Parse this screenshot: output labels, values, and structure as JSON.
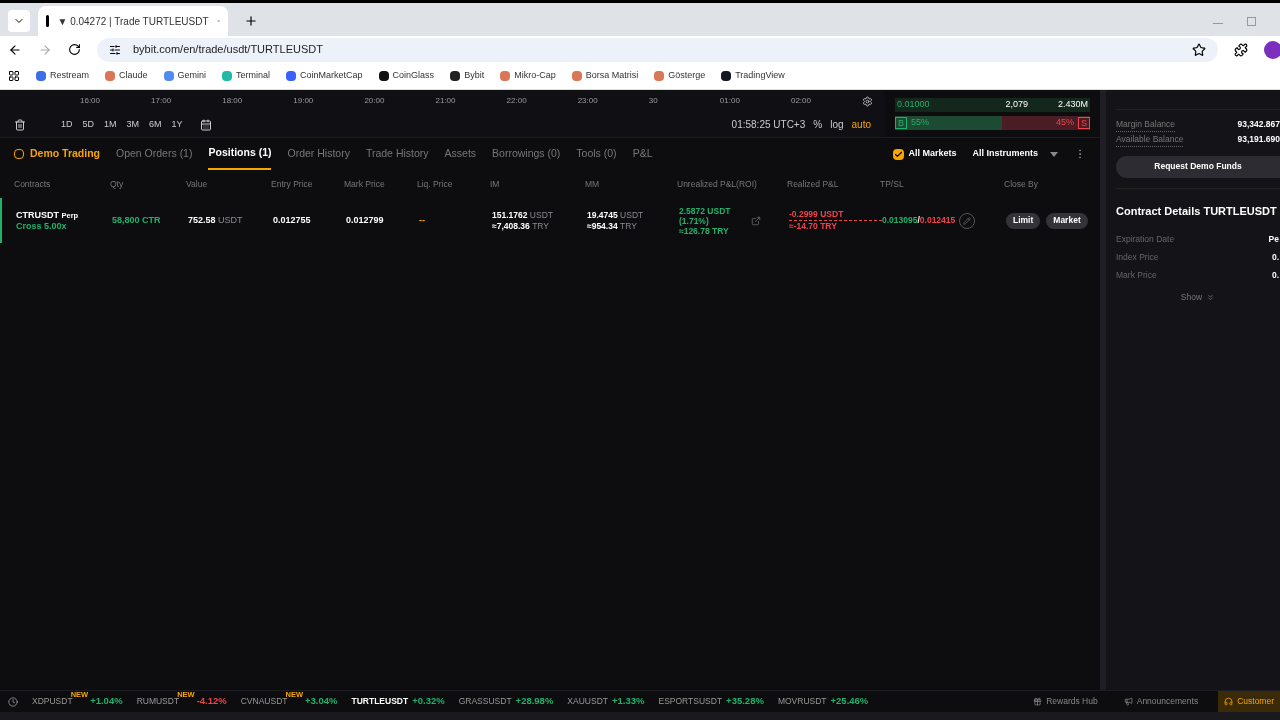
{
  "browser": {
    "tab_title": "▼ 0.04272 | Trade TURTLEUSDT",
    "url": "bybit.com/en/trade/usdt/TURTLEUSDT",
    "bookmarks": [
      {
        "label": "Restream",
        "color": "#3b6ee8"
      },
      {
        "label": "Claude",
        "color": "#d97757"
      },
      {
        "label": "Gemini",
        "color": "#4e8cf0"
      },
      {
        "label": "Terminal",
        "color": "#22b8a8"
      },
      {
        "label": "CoinMarketCap",
        "color": "#3861fb"
      },
      {
        "label": "CoinGlass",
        "color": "#111111"
      },
      {
        "label": "Bybit",
        "color": "#222222"
      },
      {
        "label": "Mikro-Cap",
        "color": "#d97757"
      },
      {
        "label": "Borsa Matrisi",
        "color": "#d97757"
      },
      {
        "label": "Gösterge",
        "color": "#d97757"
      },
      {
        "label": "TradingView",
        "color": "#131722"
      }
    ]
  },
  "chart": {
    "time_labels": [
      "16:00",
      "17:00",
      "18:00",
      "19:00",
      "20:00",
      "21:00",
      "22:00",
      "23:00",
      "30",
      "01:00",
      "02:00"
    ],
    "ranges": [
      "1D",
      "5D",
      "1M",
      "3M",
      "6M",
      "1Y"
    ],
    "clock": "01:58:25 UTC+3",
    "scales": [
      {
        "label": "%",
        "selected": false
      },
      {
        "label": "log",
        "selected": false
      },
      {
        "label": "auto",
        "selected": true
      }
    ]
  },
  "orderbook": {
    "price": "0.01000",
    "size": "2,079",
    "total": "2.430M",
    "buy_label": "B",
    "buy_pct": "55%",
    "sell_pct": "45%",
    "sell_label": "S",
    "level": 0.55
  },
  "positions": {
    "mode": "Demo Trading",
    "tabs": [
      {
        "label": "Open Orders (1)",
        "selected": false
      },
      {
        "label": "Positions (1)",
        "selected": true
      },
      {
        "label": "Order History",
        "selected": false
      },
      {
        "label": "Trade History",
        "selected": false
      },
      {
        "label": "Assets",
        "selected": false
      },
      {
        "label": "Borrowings (0)",
        "selected": false
      },
      {
        "label": "Tools (0)",
        "selected": false
      },
      {
        "label": "P&L",
        "selected": false
      }
    ],
    "all_markets": {
      "label": "All Markets",
      "checked": true
    },
    "instruments": "All Instruments",
    "columns": [
      "Contracts",
      "Qty",
      "Value",
      "Entry Price",
      "Mark Price",
      "Liq. Price",
      "IM",
      "MM",
      "Unrealized P&L(ROI)",
      "Realized P&L",
      "TP/SL",
      "Close By"
    ],
    "rows": [
      {
        "contract": "CTRUSDT",
        "tag": "Perp",
        "margin": "Cross 5.00x",
        "qty": "58,800 CTR",
        "value": "752.58",
        "value_unit": "USDT",
        "entry": "0.012755",
        "mark": "0.012799",
        "liq": "--",
        "im": [
          {
            "amount": "151.1762",
            "unit": "USDT"
          },
          {
            "amount": "≈7,408.36",
            "unit": "TRY"
          }
        ],
        "mm": [
          {
            "amount": "19.4745",
            "unit": "USDT"
          },
          {
            "amount": "≈954.34",
            "unit": "TRY"
          }
        ],
        "unrealized": [
          "2.5872 USDT",
          "(1.71%)",
          "≈126.78 TRY"
        ],
        "realized": [
          "-0.2999 USDT",
          "≈-14.70 TRY"
        ],
        "tp": "0.013095",
        "separator": "/",
        "sl": "0.012415",
        "close_by": [
          "Limit",
          "Market"
        ]
      }
    ]
  },
  "account": {
    "balances": [
      {
        "label": "Margin Balance",
        "value": "93,342.867"
      },
      {
        "label": "Available Balance",
        "value": "93,191.690"
      }
    ],
    "button": "Request Demo Funds",
    "details_title": "Contract Details TURTLEUSDT",
    "details": [
      {
        "label": "Expiration Date",
        "value": "Pe"
      },
      {
        "label": "Index Price",
        "value": "0."
      },
      {
        "label": "Mark Price",
        "value": "0."
      }
    ],
    "show": "Show"
  },
  "ticker": [
    {
      "symbol": "XDPUSDT",
      "badge": "NEW",
      "change": "+1.04%",
      "color": "#20b26c",
      "selected": false
    },
    {
      "symbol": "RUMUSDT",
      "badge": "NEW",
      "change": "-4.12%",
      "color": "#ef454a",
      "selected": false
    },
    {
      "symbol": "CVNAUSDT",
      "badge": "NEW",
      "change": "+3.04%",
      "color": "#20b26c",
      "selected": false
    },
    {
      "symbol": "TURTLEUSDT",
      "change": "+0.32%",
      "color": "#20b26c",
      "selected": true
    },
    {
      "symbol": "GRASSUSDT",
      "change": "+28.98%",
      "color": "#20b26c",
      "selected": false
    },
    {
      "symbol": "XAUUSDT",
      "change": "+1.33%",
      "color": "#20b26c",
      "selected": false
    },
    {
      "symbol": "ESPORTSUSDT",
      "change": "+35.28%",
      "color": "#20b26c",
      "selected": false
    },
    {
      "symbol": "MOVRUSDT",
      "change": "+25.46%",
      "color": "#20b26c",
      "selected": false
    }
  ],
  "footer": [
    "Rewards Hub",
    "Announcements",
    "Customer"
  ]
}
